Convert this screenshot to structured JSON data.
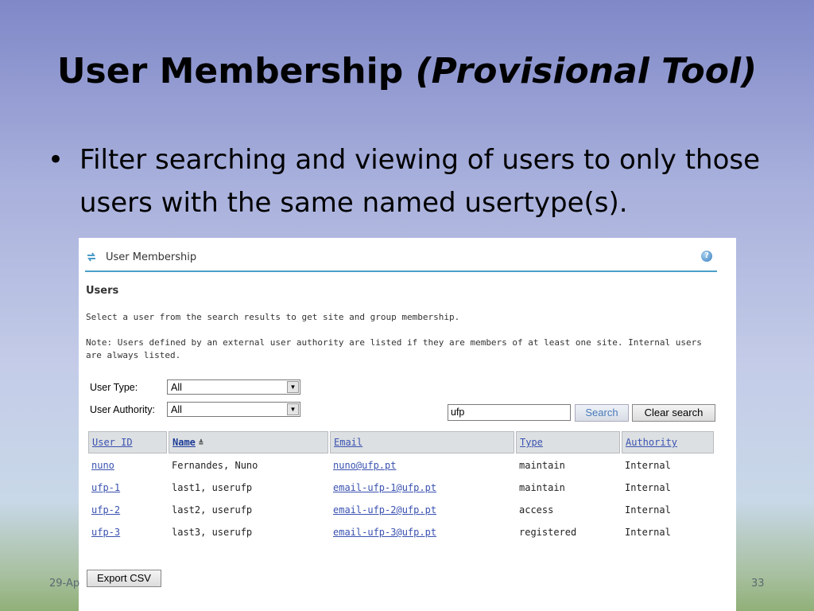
{
  "slide": {
    "title_main": "User Membership",
    "title_italic": "(Provisional Tool)",
    "bullet_symbol": "•",
    "bullet_text": "Filter searching and viewing of users to only those users with the same named usertype(s).",
    "footer_date": "29-Ap",
    "page_number": "33"
  },
  "tool": {
    "icon": "refresh-arrows-icon",
    "title": "User Membership",
    "help_icon": "help-icon",
    "help_glyph": "?",
    "section_heading": "Users",
    "instructions": "Select a user from the search results to get site and group membership.",
    "note": "Note: Users defined by an external user authority are listed if they are members of at least one site. Internal users are always listed."
  },
  "filters": {
    "user_type_label": "User Type:",
    "user_type_value": "All",
    "user_authority_label": "User Authority:",
    "user_authority_value": "All",
    "search_value": "ufp",
    "search_button": "Search",
    "clear_button": "Clear search"
  },
  "table": {
    "headers": {
      "user_id": "User ID",
      "name": "Name",
      "name_sort_glyph": "≜",
      "email": "Email",
      "type": "Type",
      "authority": "Authority"
    },
    "rows": [
      {
        "user_id": "nuno",
        "name": "Fernandes, Nuno",
        "email": "nuno@ufp.pt",
        "type": "maintain",
        "authority": "Internal"
      },
      {
        "user_id": "ufp-1",
        "name": "last1, userufp",
        "email": "email-ufp-1@ufp.pt",
        "type": "maintain",
        "authority": "Internal"
      },
      {
        "user_id": "ufp-2",
        "name": "last2, userufp",
        "email": "email-ufp-2@ufp.pt",
        "type": "access",
        "authority": "Internal"
      },
      {
        "user_id": "ufp-3",
        "name": "last3, userufp",
        "email": "email-ufp-3@ufp.pt",
        "type": "registered",
        "authority": "Internal"
      }
    ]
  },
  "export_button": "Export CSV",
  "colors": {
    "accent_rule": "#4aa0c8",
    "link": "#3a52b0",
    "header_bg": "#dde0e2"
  }
}
